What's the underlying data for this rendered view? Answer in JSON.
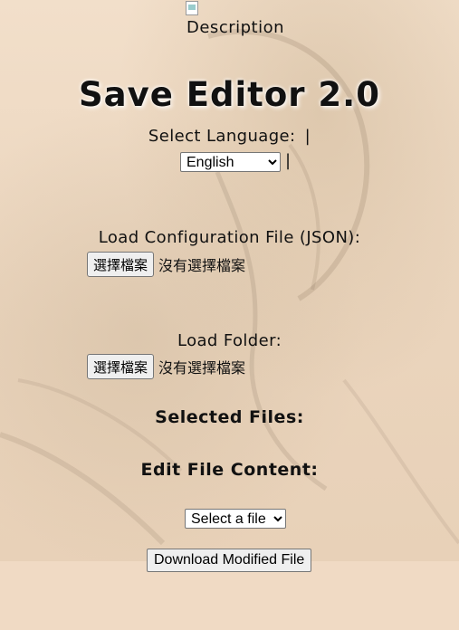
{
  "header": {
    "image_alt": "Description",
    "title": "Save Editor 2.0"
  },
  "language": {
    "label": "Select Language:",
    "separator": "|",
    "selected": "English",
    "trailing_separator": "|"
  },
  "config_file": {
    "label": "Load Configuration File (JSON):",
    "button_label": "選擇檔案",
    "status": "沒有選擇檔案"
  },
  "folder": {
    "label": "Load Folder:",
    "button_label": "選擇檔案",
    "status": "沒有選擇檔案"
  },
  "selected_files": {
    "heading": "Selected Files:"
  },
  "edit": {
    "heading": "Edit File Content:",
    "file_select_value": "Select a file"
  },
  "download": {
    "button_label": "Download Modified File"
  }
}
